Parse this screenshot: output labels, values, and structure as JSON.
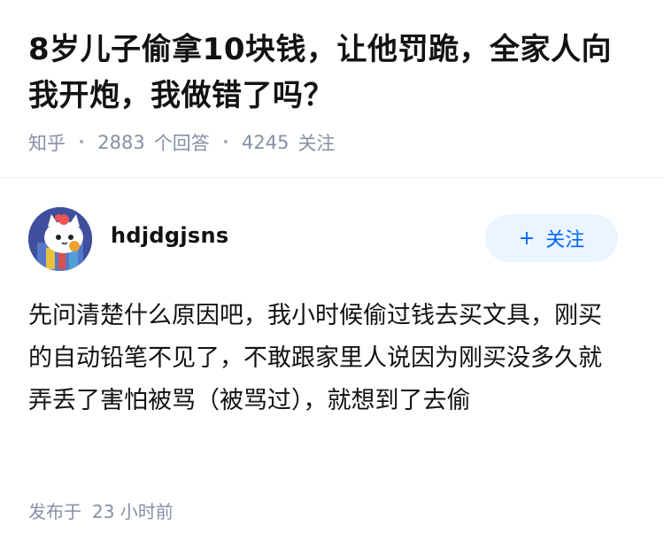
{
  "question": {
    "title": "8岁儿子偷拿10块钱，让他罚跪，全家人向我开炮，我做错了吗？",
    "source": "知乎",
    "answer_count": "2883",
    "answer_label": "个回答",
    "follower_count": "4245",
    "follower_label": "关注"
  },
  "answer": {
    "author": {
      "name": "hdjdgjsns",
      "avatar_icon": "cartoon-cat-avatar"
    },
    "follow_button": {
      "label": "关注",
      "icon": "plus-icon"
    },
    "content": "先问清楚什么原因吧，我小时候偷过钱去买文具，刚买的自动铅笔不见了，不敢跟家里人说因为刚买没多久就弄丢了害怕被骂（被骂过），就想到了去偷",
    "publish_label": "发布于",
    "publish_time": "23 小时前"
  },
  "colors": {
    "accent": "#0066ff",
    "follow_bg": "#ebf5ff",
    "meta_text": "#8590a6",
    "main_text": "#121212"
  }
}
